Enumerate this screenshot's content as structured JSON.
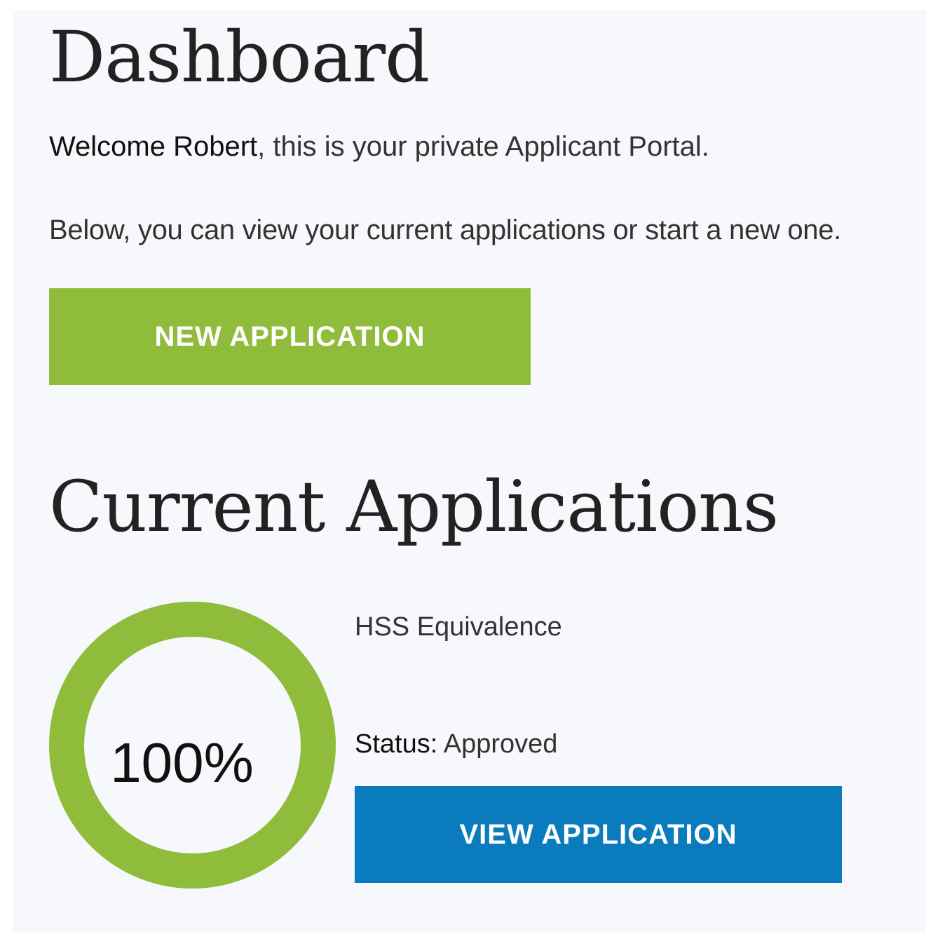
{
  "header": {
    "title": "Dashboard",
    "welcome_name": "Welcome Robert",
    "welcome_rest": ", this is your private Applicant Portal.",
    "intro": "Below, you can view your current applications or start a new one.",
    "new_button_label": "NEW APPLICATION"
  },
  "applications": {
    "section_title": "Current Applications",
    "items": [
      {
        "name": "HSS Equivalence",
        "progress_label": "100%",
        "progress": 1.0,
        "status_key": "Status:",
        "status_value": " Approved",
        "view_button_label": "VIEW APPLICATION"
      }
    ]
  },
  "colors": {
    "accent_green": "#8fbc3a",
    "accent_blue": "#0a7bbd",
    "background": "#f6f8fb"
  }
}
